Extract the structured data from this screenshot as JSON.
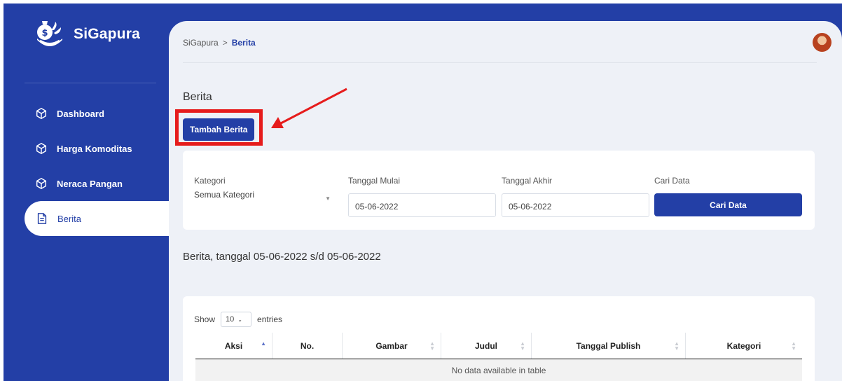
{
  "brand": {
    "name": "SiGapura"
  },
  "sidebar": {
    "items": [
      {
        "label": "Dashboard",
        "icon": "cube-icon"
      },
      {
        "label": "Harga Komoditas",
        "icon": "cube-icon"
      },
      {
        "label": "Neraca Pangan",
        "icon": "cube-icon"
      },
      {
        "label": "Berita",
        "icon": "document-icon",
        "active": true
      }
    ]
  },
  "breadcrumb": {
    "root": "SiGapura",
    "separator": ">",
    "current": "Berita"
  },
  "page": {
    "title": "Berita",
    "add_button": "Tambah Berita"
  },
  "filters": {
    "kategori_label": "Kategori",
    "kategori_value": "Semua Kategori",
    "mulai_label": "Tanggal Mulai",
    "mulai_value": "05-06-2022",
    "akhir_label": "Tanggal Akhir",
    "akhir_value": "05-06-2022",
    "cari_label": "Cari Data",
    "cari_button": "Cari Data"
  },
  "results": {
    "title": "Berita, tanggal 05-06-2022 s/d 05-06-2022"
  },
  "table": {
    "show_label": "Show",
    "length_value": "10",
    "entries_label": "entries",
    "columns": [
      "Aksi",
      "No.",
      "Gambar",
      "Judul",
      "Tanggal Publish",
      "Kategori"
    ],
    "empty_text": "No data available in table"
  },
  "colors": {
    "primary": "#233fa6",
    "highlight": "#e61c1c",
    "panel": "#eef1f7"
  }
}
